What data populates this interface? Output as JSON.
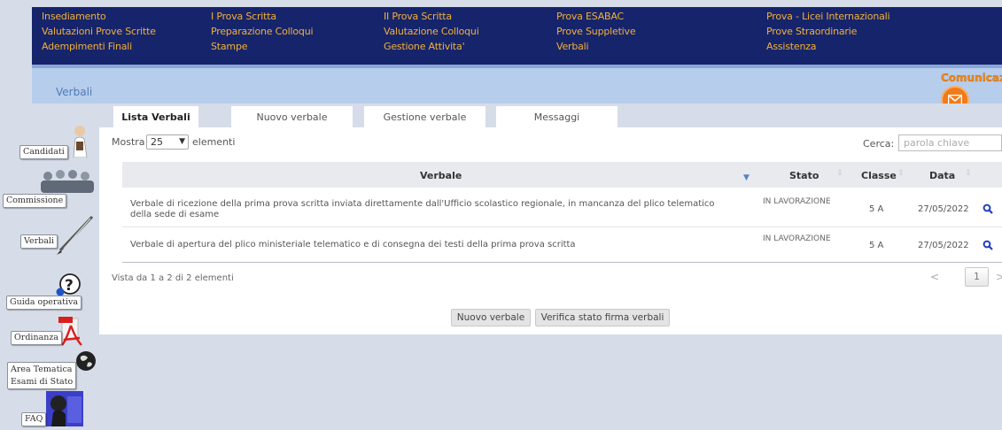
{
  "menu": {
    "col1": [
      "Insediamento",
      "Valutazioni Prove Scritte",
      "Adempimenti Finali"
    ],
    "col2": [
      "I Prova Scritta",
      "Preparazione Colloqui",
      "Stampe"
    ],
    "col3": [
      "II Prova Scritta",
      "Valutazione Colloqui",
      "Gestione Attivita'"
    ],
    "col4": [
      "Prova ESABAC",
      "Prove Suppletive",
      "Verbali"
    ],
    "col5": [
      "Prova - Licei Internazionali",
      "Prove Straordinarie",
      "Assistenza"
    ]
  },
  "page": {
    "section_title": "Verbali",
    "communications": "Comunicazioni"
  },
  "sidebar": {
    "candidati": "Candidati",
    "commissione": "Commissione",
    "verbali": "Verbali",
    "guida": "Guida operativa",
    "ordinanza": "Ordinanza",
    "area1": "Area Tematica",
    "area2": "Esami di Stato",
    "faq": "FAQ"
  },
  "tabs": [
    "Lista Verbali",
    "Nuovo verbale",
    "Gestione verbale",
    "Messaggi"
  ],
  "table_controls": {
    "show_label": "Mostra",
    "page_size": "25",
    "elements_label": "elementi",
    "search_label": "Cerca:",
    "search_placeholder": "parola chiave"
  },
  "table": {
    "columns": [
      "Verbale",
      "Stato",
      "Classe",
      "Data"
    ],
    "rows": [
      {
        "verbale": "Verbale di ricezione della prima prova scritta inviata direttamente dall'Ufficio scolastico regionale, in mancanza del plico telematico della sede di esame",
        "stato": "IN LAVORAZIONE",
        "classe": "5 A",
        "data": "27/05/2022"
      },
      {
        "verbale": "Verbale di apertura del plico ministeriale telematico e di consegna dei testi della prima prova scritta",
        "stato": "IN LAVORAZIONE",
        "classe": "5 A",
        "data": "27/05/2022"
      }
    ]
  },
  "pagination": {
    "info": "Vista da 1 a 2 di 2 elementi",
    "prev": "<",
    "current": "1",
    "next": ">"
  },
  "actions": {
    "new": "Nuovo verbale",
    "check": "Verifica stato firma verbali"
  },
  "colors": {
    "menu_bg": "#16246b",
    "menu_text": "#f2b13a",
    "subbar": "#b7cdec",
    "accent": "#f07b1a",
    "search_icon": "#1f3fbf"
  }
}
